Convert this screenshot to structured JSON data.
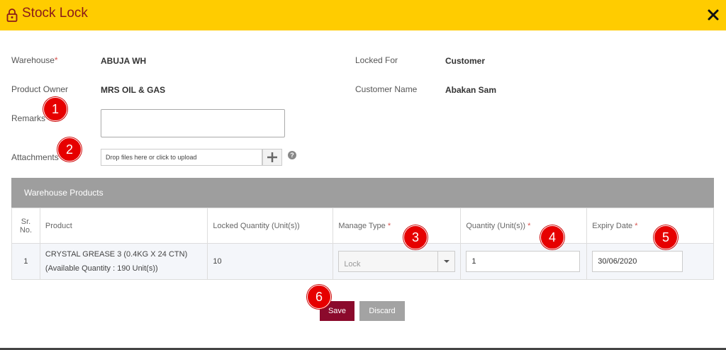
{
  "header": {
    "title": "Stock Lock",
    "icon": "lock-icon",
    "close_icon": "close-icon",
    "color": "#ffcc00"
  },
  "form": {
    "warehouse_label": "Warehouse",
    "warehouse_req": "*",
    "warehouse_value": "ABUJA WH",
    "owner_label": "Product Owner",
    "owner_value": "MRS OIL & GAS",
    "locked_for_label": "Locked For",
    "locked_for_value": "Customer",
    "customer_name_label": "Customer Name",
    "customer_name_value": "Abakan Sam",
    "remarks_label": "Remarks",
    "remarks_value": "",
    "attachments_label": "Attachments",
    "upload_placeholder": "Drop files here or click to upload",
    "help_glyph": "?"
  },
  "panel": {
    "title": "Warehouse Products"
  },
  "table": {
    "columns": {
      "sr": "Sr. No.",
      "product": "Product",
      "locked_qty": "Locked Quantity (Unit(s))",
      "manage_type": "Manage Type",
      "quantity": "Quantity (Unit(s))",
      "expiry": "Expiry Date",
      "req": "*"
    },
    "rows": [
      {
        "sr": "1",
        "product_name": "CRYSTAL GREASE 3 (0.4KG X 24 CTN)",
        "product_avail": "(Available Quantity : 190 Unit(s))",
        "locked_qty": "10",
        "manage_type": "Lock",
        "quantity": "1",
        "expiry": "30/06/2020"
      }
    ]
  },
  "actions": {
    "save_label": "Save",
    "discard_label": "Discard",
    "save_color": "#8b0a2c"
  },
  "badges": [
    "1",
    "2",
    "3",
    "4",
    "5",
    "6"
  ]
}
